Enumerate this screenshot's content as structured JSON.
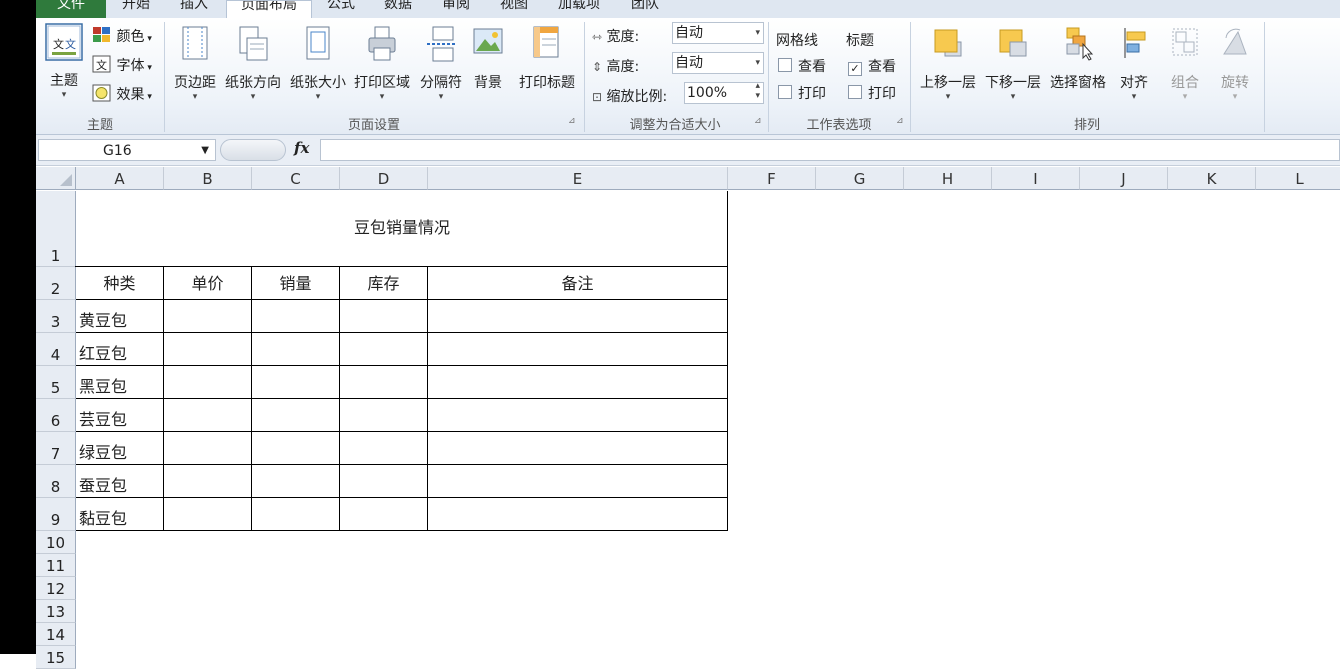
{
  "tabs": [
    "文件",
    "开始",
    "插入",
    "页面布局",
    "公式",
    "数据",
    "审阅",
    "视图",
    "加载项",
    "团队"
  ],
  "ribbon": {
    "theme_group": {
      "label": "主题",
      "themes_button": "主题",
      "colors": "颜色",
      "fonts": "字体",
      "effects": "效果"
    },
    "page_setup_group": {
      "label": "页面设置",
      "margins": "页边距",
      "orientation": "纸张方向",
      "size": "纸张大小",
      "print_area": "打印区域",
      "breaks": "分隔符",
      "background": "背景",
      "print_titles": "打印标题"
    },
    "scale_group": {
      "label": "调整为合适大小",
      "width_label": "宽度:",
      "width_value": "自动",
      "height_label": "高度:",
      "height_value": "自动",
      "scale_label": "缩放比例:",
      "scale_value": "100%"
    },
    "sheet_options_group": {
      "label": "工作表选项",
      "gridlines": "网格线",
      "headings": "标题",
      "view": "查看",
      "print": "打印",
      "gridlines_view_checked": false,
      "gridlines_print_checked": false,
      "headings_view_checked": true,
      "headings_print_checked": false
    },
    "arrange_group": {
      "label": "排列",
      "bring_forward": "上移一层",
      "send_backward": "下移一层",
      "selection_pane": "选择窗格",
      "align": "对齐",
      "group": "组合",
      "rotate": "旋转"
    }
  },
  "formula_bar": {
    "name_box": "G16",
    "fx": "fx",
    "formula": ""
  },
  "columns": [
    "A",
    "B",
    "C",
    "D",
    "E",
    "F",
    "G",
    "H",
    "I",
    "J",
    "K",
    "L"
  ],
  "rows": [
    "1",
    "2",
    "3",
    "4",
    "5",
    "6",
    "7",
    "8",
    "9",
    "10",
    "11",
    "12",
    "13",
    "14",
    "15"
  ],
  "sheet": {
    "title": "豆包销量情况",
    "headers": [
      "种类",
      "单价",
      "销量",
      "库存",
      "备注"
    ],
    "items": [
      "黄豆包",
      "红豆包",
      "黑豆包",
      "芸豆包",
      "绿豆包",
      "蚕豆包",
      "黏豆包"
    ]
  }
}
